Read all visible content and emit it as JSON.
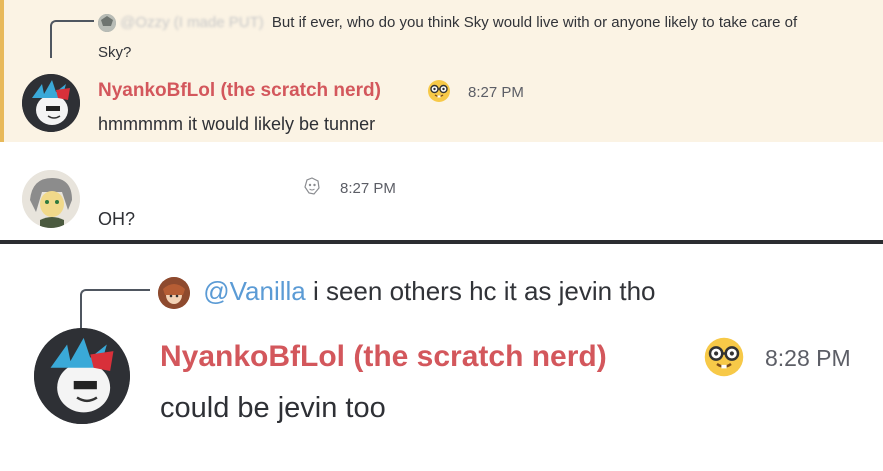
{
  "top_panel": {
    "reply1": {
      "author": "@Ozzy (I made PUT)",
      "text": "But if ever, who do you think Sky would live with or anyone likely to take care of",
      "text_cont": "Sky?"
    },
    "msg1": {
      "username": "NyankoBfLol (the scratch nerd)",
      "badge_icon": "nerd-face-emoji",
      "timestamp": "8:27 PM",
      "text": "hmmmmm it would likely be tunner"
    },
    "msg2": {
      "username": "",
      "timestamp": "8:27 PM",
      "text": "OH?"
    }
  },
  "bottom_panel": {
    "reply2": {
      "mention": "@Vanilla",
      "text": " i seen others hc it as jevin tho"
    },
    "msg3": {
      "username": "NyankoBfLol (the scratch nerd)",
      "badge_icon": "nerd-face-emoji",
      "timestamp": "8:28 PM",
      "text": "could be jevin too"
    }
  },
  "colors": {
    "username": "#d3575c",
    "mention": "#5b9bd5",
    "highlight_bg": "#fbf3e4",
    "highlight_bar": "#e8b95a",
    "separator": "#2b2d31"
  }
}
